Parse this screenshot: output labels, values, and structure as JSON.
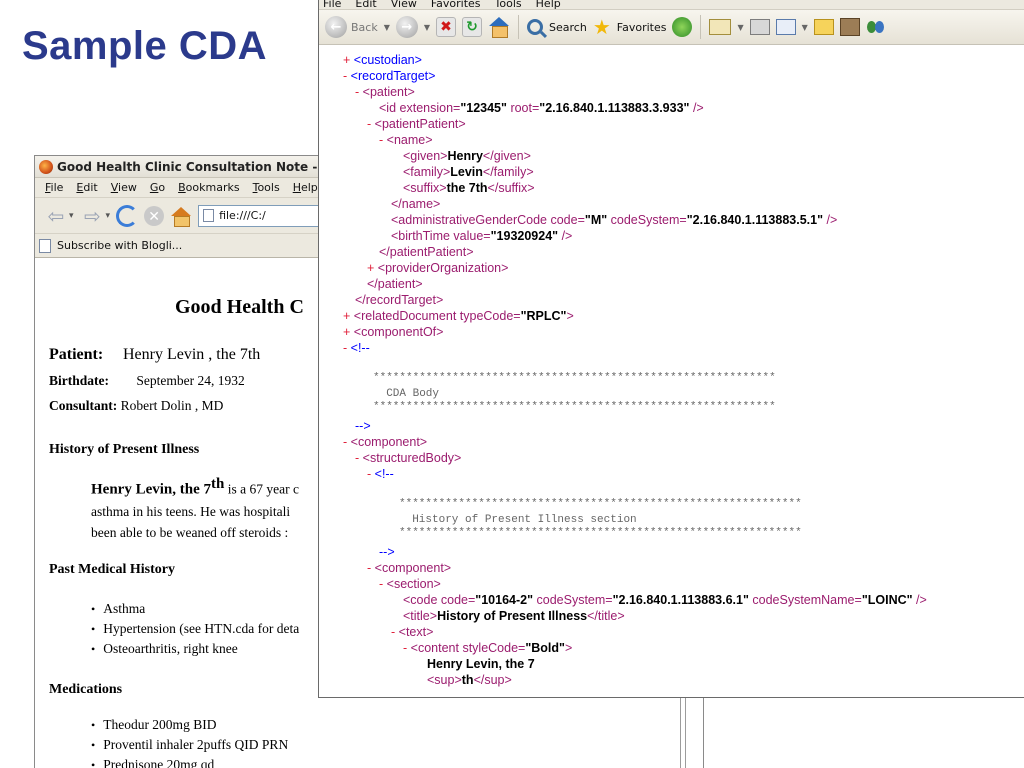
{
  "slide": {
    "title": "Sample CDA"
  },
  "firefox": {
    "window_title": "Good Health Clinic Consultation Note - M",
    "menu": [
      "File",
      "Edit",
      "View",
      "Go",
      "Bookmarks",
      "Tools",
      "Help"
    ],
    "url": "file:///C:/",
    "bookmark": "Subscribe with Blogli...",
    "document": {
      "title": "Good Health C",
      "patient_label": "Patient:",
      "patient_value": "Henry Levin , the 7th",
      "birthdate_label": "Birthdate:",
      "birthdate_value": "September 24, 1932",
      "consultant_label": "Consultant:",
      "consultant_value": "Robert Dolin , MD",
      "hpi_heading": "History of Present Illness",
      "hpi_name": "Henry Levin, the 7",
      "hpi_sup": "th",
      "hpi_line1": "is a 67 year c",
      "hpi_line2": "asthma in his teens. He was hospitali",
      "hpi_line3": "been able to be weaned off steroids :",
      "pmh_heading": "Past Medical History",
      "pmh_items": [
        "Asthma",
        "Hypertension (see HTN.cda for deta",
        "Osteoarthritis, right knee"
      ],
      "meds_heading": "Medications",
      "meds_items": [
        "Theodur 200mg BID",
        "Proventil inhaler 2puffs QID PRN",
        "Prednisone 20mg qd"
      ]
    }
  },
  "ie": {
    "menu": [
      "File",
      "Edit",
      "View",
      "Favorites",
      "Tools",
      "Help"
    ],
    "toolbar": {
      "back": "Back",
      "search": "Search",
      "favorites": "Favorites"
    },
    "xml": {
      "custodian": "<custodian>",
      "recordTarget_open": "<recordTarget>",
      "patient_open": "<patient>",
      "id_tag": "<id",
      "id_ext_attr": "extension=",
      "id_ext_val": "\"12345\"",
      "id_root_attr": "root=",
      "id_root_val": "\"2.16.840.1.113883.3.933\"",
      "id_close": "/>",
      "patientPatient_open": "<patientPatient>",
      "name_open": "<name>",
      "given_open": "<given>",
      "given_text": "Henry",
      "given_close": "</given>",
      "family_open": "<family>",
      "family_text": "Levin",
      "family_close": "</family>",
      "suffix_open": "<suffix>",
      "suffix_text": "the 7th",
      "suffix_close": "</suffix>",
      "name_close": "</name>",
      "agc_tag": "<administrativeGenderCode",
      "agc_code_attr": "code=",
      "agc_code_val": "\"M\"",
      "agc_cs_attr": "codeSystem=",
      "agc_cs_val": "\"2.16.840.1.113883.5.1\"",
      "agc_close": "/>",
      "bt_tag": "<birthTime",
      "bt_value_attr": "value=",
      "bt_value_val": "\"19320924\"",
      "bt_close": "/>",
      "patientPatient_close": "</patientPatient>",
      "providerOrganization": "<providerOrganization>",
      "patient_close": "</patient>",
      "recordTarget_close": "</recordTarget>",
      "relatedDocument_tag": "<relatedDocument",
      "relatedDocument_attr": "typeCode=",
      "relatedDocument_val": "\"RPLC\"",
      "relatedDocument_close": ">",
      "componentOf": "<componentOf>",
      "comment_open": "<!--",
      "stars": "*************************************************************",
      "cda_body": "CDA Body",
      "comment_close": "-->",
      "component_open": "<component>",
      "structuredBody_open": "<structuredBody>",
      "comment2_open": "<!--",
      "stars2": "*************************************************************",
      "hpi_section": "History of Present Illness section",
      "comment2_close": "-->",
      "component2_open": "<component>",
      "section_open": "<section>",
      "code_tag": "<code",
      "code_code_attr": "code=",
      "code_code_val": "\"10164-2\"",
      "code_cs_attr": "codeSystem=",
      "code_cs_val": "\"2.16.840.1.113883.6.1\"",
      "code_csn_attr": "codeSystemName=",
      "code_csn_val": "\"LOINC\"",
      "code_close": "/>",
      "title_open": "<title>",
      "title_text": "History of Present Illness",
      "title_close": "</title>",
      "text_open": "<text>",
      "content_tag": "<content",
      "content_attr": "styleCode=",
      "content_val": "\"Bold\"",
      "content_close": ">",
      "content_text": "Henry Levin, the 7",
      "sup_open": "<sup>",
      "sup_text": "th",
      "sup_close": "</sup>"
    }
  },
  "markers": {
    "plus": "+",
    "minus": "-"
  }
}
